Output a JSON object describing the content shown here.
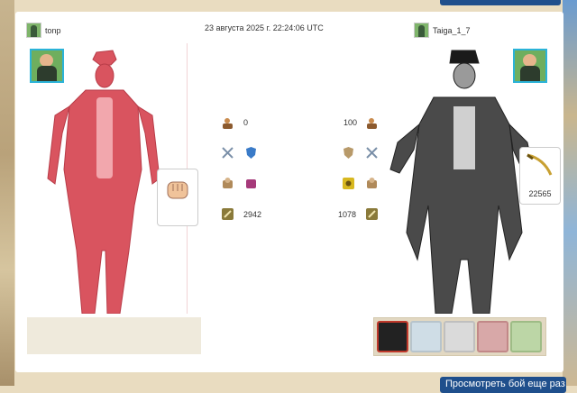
{
  "header": {
    "player1": "tonp",
    "timestamp": "23 августа 2025 г. 22:24:06 UTC",
    "player2": "Taiga_1_7"
  },
  "left_stats": {
    "value1": "0",
    "value4": "2942"
  },
  "right_stats": {
    "value1": "100",
    "value4": "1078"
  },
  "weapon": {
    "value": "22565"
  },
  "buttons": {
    "top": "",
    "bottom": "Просмотреть бой еще раз"
  },
  "colors": {
    "accent": "#1f4f8c",
    "left_char": "#d9545f",
    "right_char": "#555555"
  },
  "icons": {
    "stat_rows": [
      "strength-icon",
      "defense-icon",
      "armor-icon",
      "damage-icon"
    ],
    "skills": [
      "skill-fury-icon",
      "skill-shield-icon",
      "skill-stun-icon",
      "skill-rage-icon",
      "skill-heal-icon"
    ]
  }
}
